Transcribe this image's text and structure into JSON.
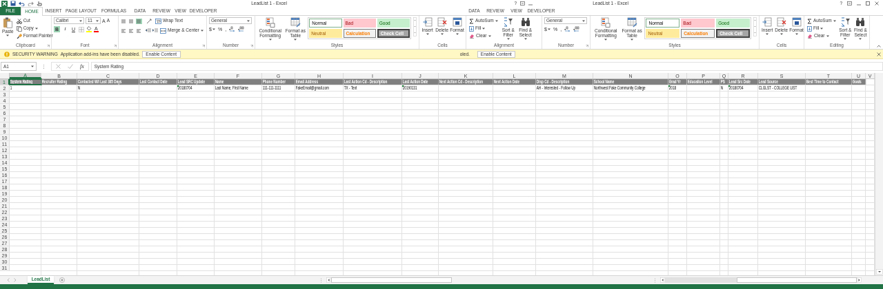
{
  "window": {
    "title": "LeadList 1 - Excel",
    "help": "?"
  },
  "window_2": {
    "title": "LeadList 1 - Excel",
    "help": "?"
  },
  "tabs": [
    {
      "label": "FILE",
      "kind": "file",
      "selected": false
    },
    {
      "label": "HOME",
      "kind": "tab",
      "selected": true
    },
    {
      "label": "INSERT",
      "kind": "tab",
      "selected": false
    },
    {
      "label": "PAGE LAYOUT",
      "kind": "tab",
      "selected": false
    },
    {
      "label": "FORMULAS",
      "kind": "tab",
      "selected": false
    },
    {
      "label": "DATA",
      "kind": "tab",
      "selected": false
    },
    {
      "label": "REVIEW",
      "kind": "tab",
      "selected": false
    },
    {
      "label": "VIEW",
      "kind": "tab",
      "selected": false
    },
    {
      "label": "DEVELOPER",
      "kind": "tab",
      "selected": false
    }
  ],
  "tabs_2": [
    {
      "label": "DATA",
      "selected": false
    },
    {
      "label": "REVIEW",
      "selected": false
    },
    {
      "label": "VIEW",
      "selected": false
    },
    {
      "label": "DEVELOPER",
      "selected": false
    }
  ],
  "ribbon": {
    "groups": [
      {
        "kind": "clipboard",
        "label": "Clipboard",
        "paste": "Paste",
        "cut": "Cut",
        "copy": "Copy",
        "format_painter": "Format Painter"
      },
      {
        "kind": "font",
        "label": "Font",
        "font": "Calibri",
        "size": "11",
        "grow": "A",
        "shrink": "A",
        "styles": [
          {
            "label": "B",
            "selected": true
          },
          {
            "label": "I",
            "selected": false
          },
          {
            "label": "U",
            "selected": false
          }
        ],
        "font_color": "A"
      },
      {
        "kind": "alignment",
        "label": "Alignment",
        "vertical": [
          {
            "selected": false
          },
          {
            "selected": false
          },
          {
            "selected": true
          }
        ],
        "wrap": "Wrap Text",
        "merge": "Merge & Center"
      },
      {
        "kind": "number",
        "label": "Number",
        "format": "General",
        "symbols": [
          "$",
          "%",
          ","
        ]
      },
      {
        "kind": "styles",
        "label": "Styles",
        "conditional": "Conditional Formatting",
        "table": "Format as Table",
        "cells": [
          {
            "kind": "normal",
            "label": "Normal"
          },
          {
            "kind": "bad",
            "label": "Bad"
          },
          {
            "kind": "good",
            "label": "Good"
          },
          {
            "kind": "neutral",
            "label": "Neutral"
          },
          {
            "kind": "calculation",
            "label": "Calculation"
          },
          {
            "kind": "check",
            "label": "Check Cell"
          }
        ]
      },
      {
        "kind": "cells",
        "label": "Cells",
        "buttons": [
          "Insert",
          "Delete",
          "Format"
        ]
      },
      {
        "kind": "editing",
        "label": "Alignment",
        "autosum": "AutoSum",
        "fill": "Fill",
        "clear": "Clear",
        "sort": "Sort & Filter",
        "find": "Find & Select"
      },
      {
        "kind": "number",
        "label": "Number",
        "format": "General",
        "symbols": [
          "$",
          "%",
          ","
        ]
      },
      {
        "kind": "styles",
        "label": "Styles",
        "conditional": "Conditional Formatting",
        "table": "Format as Table",
        "cells": [
          {
            "kind": "normal",
            "label": "Normal"
          },
          {
            "kind": "bad",
            "label": "Bad"
          },
          {
            "kind": "good",
            "label": "Good"
          },
          {
            "kind": "neutral",
            "label": "Neutral"
          },
          {
            "kind": "calculation",
            "label": "Calculation"
          },
          {
            "kind": "check",
            "label": "Check Cell"
          }
        ]
      },
      {
        "kind": "cells",
        "label": "Cells",
        "buttons": [
          "Insert",
          "Delete",
          "Format"
        ]
      },
      {
        "kind": "editing",
        "label": "Editing",
        "autosum": "AutoSum",
        "fill": "Fill",
        "clear": "Clear",
        "sort": "Sort & Filter",
        "find": "Find & Select"
      }
    ]
  },
  "security_bar": {
    "title": "SECURITY WARNING",
    "message": "Application add-ins have been disabled.",
    "button": "Enable Content",
    "message_2": "oled.",
    "button_2": "Enable Content"
  },
  "formula_bar": {
    "name_box": "A1",
    "fx": "fx",
    "formula": "System Rating"
  },
  "sheet": {
    "columns": [
      {
        "label": "A",
        "selected": true
      },
      {
        "label": "B",
        "selected": false
      },
      {
        "label": "C",
        "selected": false
      },
      {
        "label": "D",
        "selected": false
      },
      {
        "label": "E",
        "selected": false
      },
      {
        "label": "F",
        "selected": false
      },
      {
        "label": "G",
        "selected": false
      },
      {
        "label": "H",
        "selected": false
      },
      {
        "label": "I",
        "selected": false
      },
      {
        "label": "J",
        "selected": false
      },
      {
        "label": "K",
        "selected": false
      },
      {
        "label": "L",
        "selected": false
      },
      {
        "label": "M",
        "selected": false
      },
      {
        "label": "N",
        "selected": false
      },
      {
        "label": "O",
        "selected": false
      },
      {
        "label": "P",
        "selected": false
      },
      {
        "label": "Q",
        "selected": false
      },
      {
        "label": "R",
        "selected": false
      },
      {
        "label": "S",
        "selected": false
      },
      {
        "label": "T",
        "selected": false
      },
      {
        "label": "U",
        "selected": false
      },
      {
        "label": "V",
        "selected": false
      }
    ],
    "rows": [
      {
        "label": "1",
        "selected": true,
        "kind": "header",
        "cells": [
          "System Rating",
          "Recruiter Rating",
          "Contacted W/I Last 365 Days",
          "Last Contact Date",
          "Lead SRC Update",
          "Name",
          "Phone Number",
          "Email Address",
          "Last Action Cd - Description",
          "Last Action Date",
          "Next Action Cd - Description",
          "Next Action Date",
          "Disp Cd - Description",
          "School Name",
          "Grad Yr",
          "Education Level",
          "PS",
          "Lead Src Date",
          "Lead Source",
          "Best Time to Contact",
          "Goals",
          null
        ]
      },
      {
        "label": "2",
        "selected": false,
        "kind": "data",
        "cells": [
          {
            "text": "1",
            "flagged": false
          },
          null,
          {
            "text": "N",
            "flagged": false
          },
          null,
          {
            "text": "20180704",
            "flagged": true
          },
          {
            "text": "Last Name, First Name",
            "flagged": false
          },
          {
            "text": "111-111-1111",
            "flagged": false
          },
          {
            "text": "FakeEmail@gmail.com",
            "flagged": false
          },
          {
            "text": "TX - Text",
            "flagged": false
          },
          {
            "text": "20190131",
            "flagged": true
          },
          null,
          null,
          {
            "text": "AH - Interested - Follow Up",
            "flagged": false
          },
          {
            "text": "Northwest Fake Community College",
            "flagged": false
          },
          {
            "text": "2018",
            "flagged": true
          },
          null,
          {
            "text": "N",
            "flagged": false
          },
          {
            "text": "20180704",
            "flagged": true
          },
          {
            "text": "CLGLST - COLLEGE LIST",
            "flagged": false
          },
          null,
          null,
          null
        ]
      },
      {
        "label": "3",
        "selected": false
      },
      {
        "label": "4",
        "selected": false
      },
      {
        "label": "5",
        "selected": false
      },
      {
        "label": "6",
        "selected": false
      },
      {
        "label": "7",
        "selected": false
      },
      {
        "label": "8",
        "selected": false
      },
      {
        "label": "9",
        "selected": false
      },
      {
        "label": "10",
        "selected": false
      },
      {
        "label": "11",
        "selected": false
      },
      {
        "label": "12",
        "selected": false
      },
      {
        "label": "13",
        "selected": false
      },
      {
        "label": "14",
        "selected": false
      },
      {
        "label": "15",
        "selected": false
      },
      {
        "label": "16",
        "selected": false
      },
      {
        "label": "17",
        "selected": false
      },
      {
        "label": "18",
        "selected": false
      },
      {
        "label": "19",
        "selected": false
      },
      {
        "label": "20",
        "selected": false
      },
      {
        "label": "21",
        "selected": false
      },
      {
        "label": "22",
        "selected": false
      },
      {
        "label": "23",
        "selected": false
      },
      {
        "label": "24",
        "selected": false
      },
      {
        "label": "25",
        "selected": false
      },
      {
        "label": "26",
        "selected": false
      },
      {
        "label": "27",
        "selected": false
      },
      {
        "label": "28",
        "selected": false
      },
      {
        "label": "29",
        "selected": false
      },
      {
        "label": "30",
        "selected": false
      },
      {
        "label": "31",
        "selected": false
      }
    ]
  },
  "sheet_tabs": [
    {
      "label": "LeadList",
      "selected": true
    }
  ]
}
